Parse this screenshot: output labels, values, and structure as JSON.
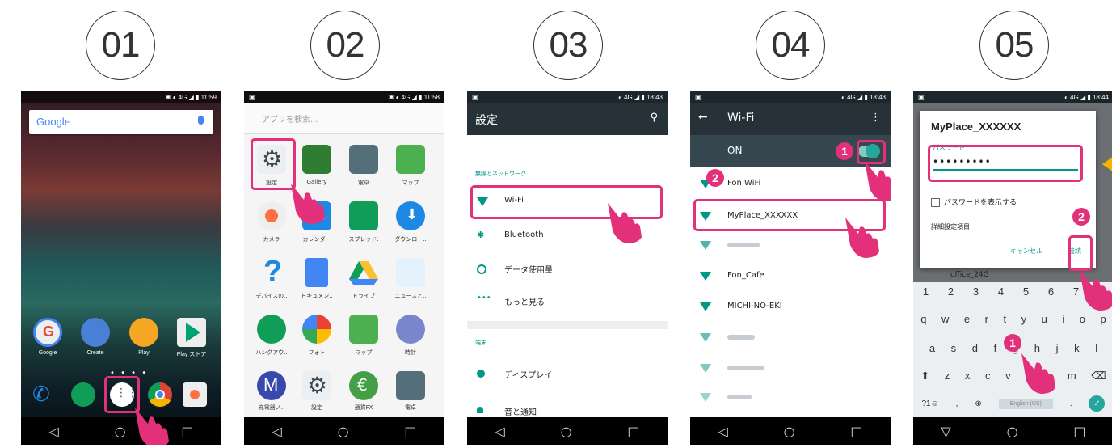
{
  "steps": [
    "01",
    "02",
    "03",
    "04",
    "05"
  ],
  "phone1": {
    "status": "✱ ◐ 4G ◢ ▮ 11:59",
    "search_label": "Google",
    "dock_labels": [
      "Google",
      "Create",
      "Play",
      "Play ストア"
    ]
  },
  "phone2": {
    "status": "✱ ◐ 4G ◢ ▮ 11:58",
    "search_placeholder": "アプリを検索...",
    "apps": [
      "設定",
      "Gallery",
      "電卓",
      "マップ",
      "カメラ",
      "カレンダー",
      "スプレッド.",
      "ダウンロー..",
      "デバイスの..",
      "ドキュメン..",
      "ドライブ",
      "ニュースと..",
      "ハングアウ..",
      "フォト",
      "マップ",
      "時計",
      "充電器ノ..",
      "設定",
      "通貨FX",
      "電卓"
    ]
  },
  "phone3": {
    "status": "◐ 4G ◢ ▮ 18:43",
    "title": "設定",
    "section1": "無線とネットワーク",
    "items": [
      "Wi-Fi",
      "Bluetooth",
      "データ使用量",
      "もっと見る"
    ],
    "section2": "端末",
    "items2": [
      "ディスプレイ",
      "音と通知"
    ]
  },
  "phone4": {
    "status": "◐ 4G ◢ ▮ 18:43",
    "title": "Wi-Fi",
    "on_label": "ON",
    "networks": [
      "Fon WiFi",
      "MyPlace_XXXXXX",
      "",
      "Fon_Cafe",
      "MICHI-NO-EKI",
      "",
      "",
      ""
    ],
    "badge1": "1",
    "badge2": "2"
  },
  "phone5": {
    "status": "◐ 4G ◢ ▮ 18:44",
    "dialog_title": "MyPlace_XXXXXX",
    "password_label": "パスワード",
    "password_value": "•••••••••",
    "show_password": "パスワードを表示する",
    "advanced": "詳細設定項目",
    "cancel": "キャンセル",
    "connect": "接続",
    "behind_item": "office_24G",
    "keyboard": {
      "row1": [
        "1",
        "2",
        "3",
        "4",
        "5",
        "6",
        "7",
        "8"
      ],
      "row2": [
        "q",
        "w",
        "e",
        "r",
        "t",
        "y",
        "u",
        "i",
        "o",
        "p"
      ],
      "row3": [
        "a",
        "s",
        "d",
        "f",
        "g",
        "h",
        "j",
        "k",
        "l"
      ],
      "row4": [
        "⬆",
        "z",
        "x",
        "c",
        "v",
        "b",
        "n",
        "m",
        "⌫"
      ],
      "row5_sym": "?1☺",
      "row5_comma": ",",
      "row5_globe": "⊕",
      "row5_space": "English (US)",
      "row5_period": ".",
      "row5_enter": "✓"
    },
    "badge1": "1",
    "badge2": "2"
  },
  "colors": {
    "accent": "#e3307a",
    "teal": "#009688",
    "appbar": "#263238"
  }
}
